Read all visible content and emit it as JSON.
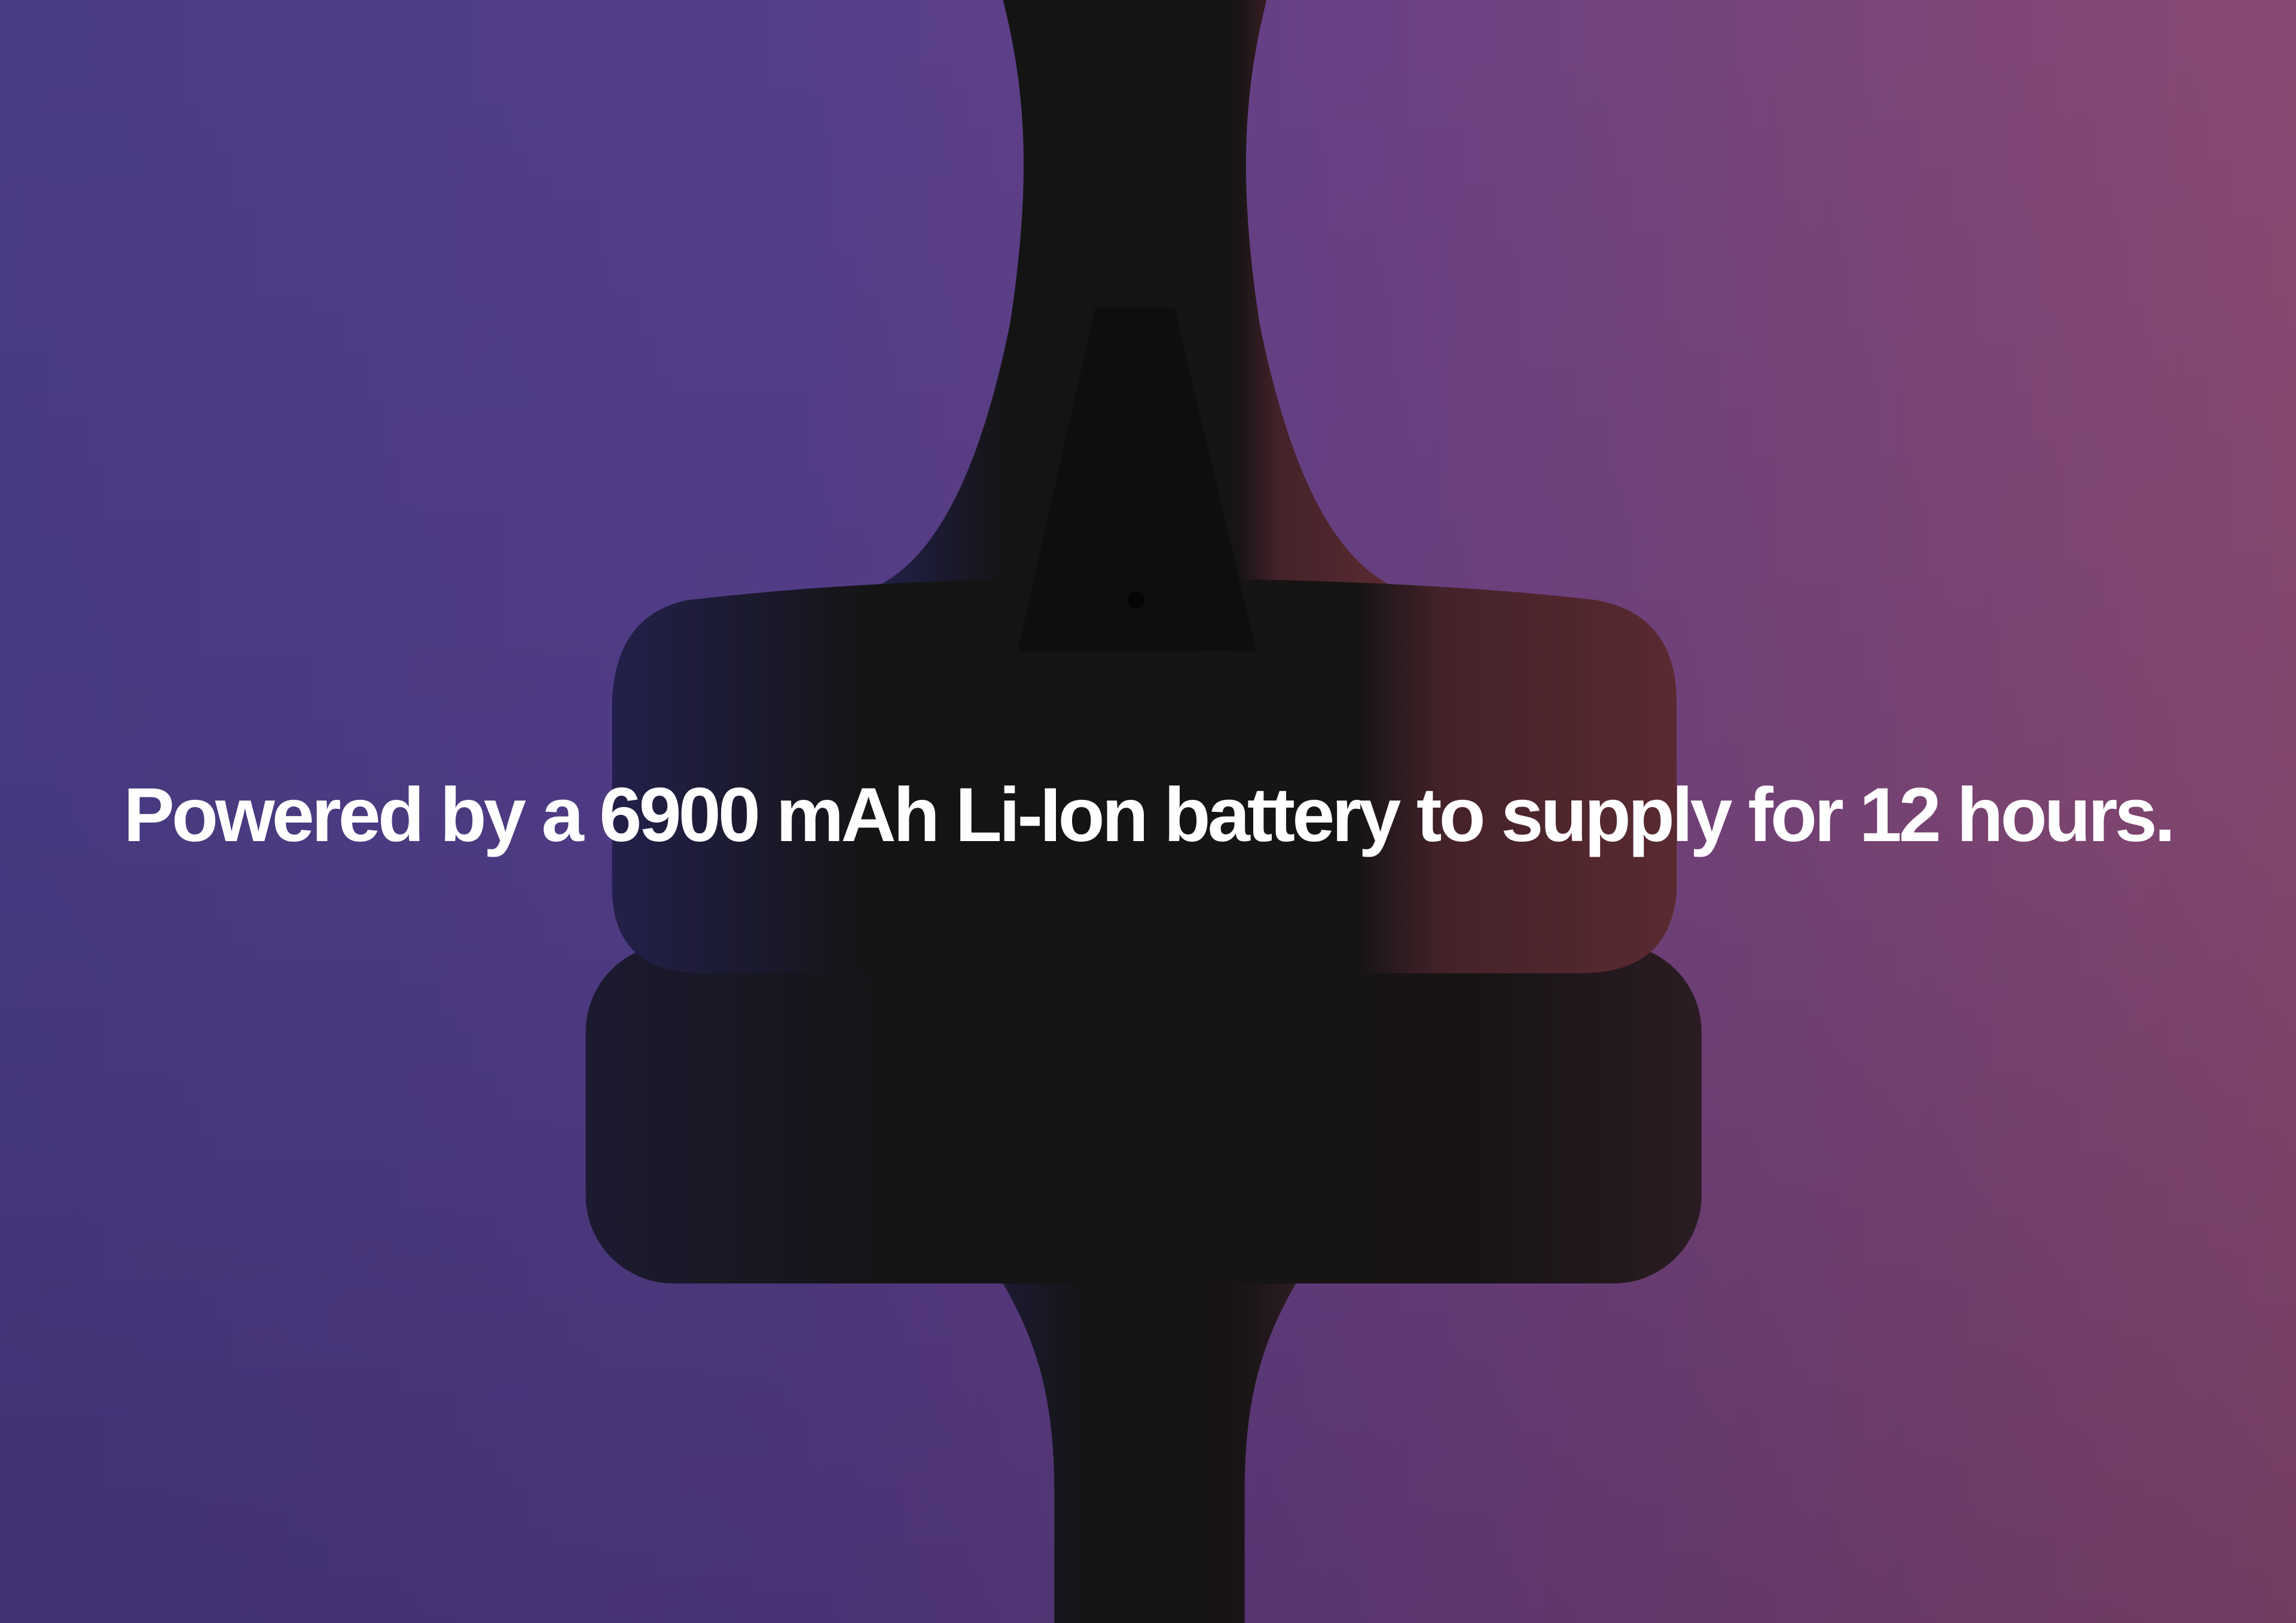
{
  "headline": "Powered by a 6900 mAh Li-Ion battery to supply for 12 hours.",
  "colors": {
    "background_left": "#4a3c86",
    "background_right": "#884a72",
    "device": "#151515",
    "device_highlight": "#4a2228"
  }
}
